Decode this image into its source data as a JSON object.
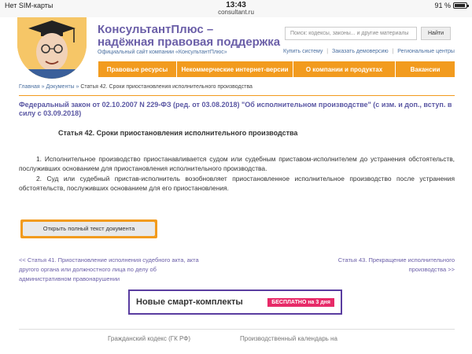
{
  "status_bar": {
    "carrier": "Нет SIM-карты",
    "time": "13:43",
    "url": "consultant.ru",
    "battery": "91 %",
    "battery_level": 0.91
  },
  "header": {
    "brand_line1": "КонсультантПлюс –",
    "brand_line2": "надёжная правовая поддержка",
    "brand_sub": "Официальный сайт компании «КонсультантПлюс»",
    "search_placeholder": "Поиск: кодексы, законы... и другие материалы",
    "search_button": "Найти",
    "top_links": [
      "Купить систему",
      "Заказать демоверсию",
      "Региональные центры"
    ]
  },
  "nav": {
    "items": [
      "Правовые ресурсы",
      "Некоммерческие интернет-версии",
      "О компании и продуктах",
      "Вакансии"
    ]
  },
  "breadcrumb": {
    "home": "Главная",
    "sep": "»",
    "documents": "Документы",
    "current": "Статья 42. Сроки приостановления исполнительного производства"
  },
  "document": {
    "title": "Федеральный закон от 02.10.2007 N 229-ФЗ (ред. от 03.08.2018) \"Об исполнительном производстве\" (с изм. и доп., вступ. в силу с 03.09.2018)",
    "article_title": "Статья 42. Сроки приостановления исполнительного производства",
    "paragraphs": [
      "1. Исполнительное производство приостанавливается судом или судебным приставом-исполнителем до устранения обстоятельств, послуживших основанием для приостановления исполнительного производства.",
      "2. Суд или судебный пристав-исполнитель возобновляет приостановленное исполнительное производство после устранения обстоятельств, послуживших основанием для его приостановления."
    ],
    "open_button": "Открыть полный текст документа"
  },
  "article_nav": {
    "prev": "<< Статья 41. Приостановление исполнения судебного акта, акта другого органа или должностного лица по делу об административном правонарушении",
    "next": "Статья 43. Прекращение исполнительного производства >>"
  },
  "banner": {
    "left": "Новые смарт-комплекты",
    "right": "БЕСПЛАТНО на 3 дня"
  },
  "footer": {
    "left": "Гражданский кодекс (ГК РФ)",
    "right": "Производственный календарь на"
  }
}
